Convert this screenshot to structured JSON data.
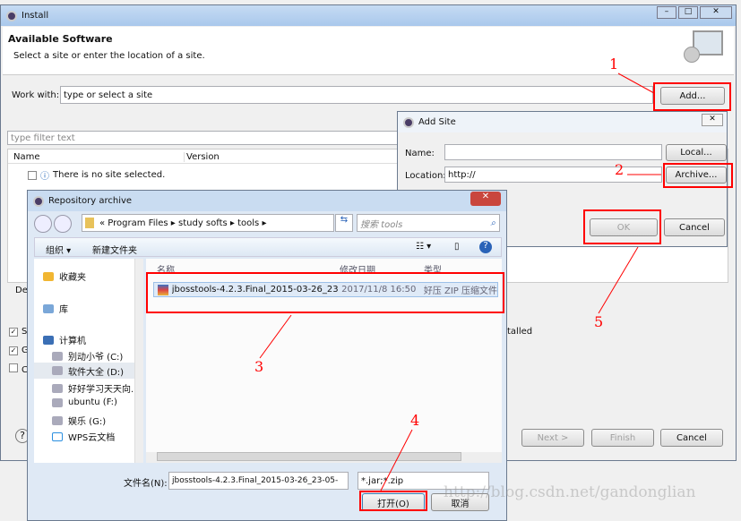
{
  "install": {
    "title": "Install",
    "heading": "Available Software",
    "subheading": "Select a site or enter the location of a site.",
    "work_with_label": "Work with:",
    "work_with_placeholder": "type or select a site",
    "add_button": "Add...",
    "filter_placeholder": "type filter text",
    "columns": [
      "Name",
      "Version"
    ],
    "no_site": "There is no site selected.",
    "checkbox_fragments": [
      "S",
      "G",
      "C"
    ],
    "details_fragment": "De",
    "installed_fragment": "talled",
    "buttons": {
      "next": "Next >",
      "finish": "Finish",
      "cancel": "Cancel"
    }
  },
  "add_site": {
    "title": "Add Site",
    "name_label": "Name:",
    "name_value": "",
    "location_label": "Location:",
    "location_value": "http://",
    "local_button": "Local...",
    "archive_button": "Archive...",
    "ok_button": "OK",
    "cancel_button": "Cancel"
  },
  "repo": {
    "title": "Repository archive",
    "breadcrumb": [
      "Program Files",
      "study softs",
      "tools"
    ],
    "search_placeholder": "搜索 tools",
    "organize": "组织 ▾",
    "new_folder": "新建文件夹",
    "columns": [
      "名称",
      "修改日期",
      "类型"
    ],
    "nav": [
      {
        "label": "收藏夹",
        "icon": "star-icon"
      },
      {
        "label": "库",
        "icon": "library-icon"
      },
      {
        "label": "计算机",
        "icon": "computer-icon"
      },
      {
        "label": "别动小爷 (C:)",
        "icon": "drive-icon"
      },
      {
        "label": "软件大全 (D:)",
        "icon": "drive-icon"
      },
      {
        "label": "好好学习天天向...",
        "icon": "drive-icon"
      },
      {
        "label": "ubuntu (F:)",
        "icon": "drive-icon"
      },
      {
        "label": "娱乐 (G:)",
        "icon": "drive-icon"
      },
      {
        "label": "WPS云文档",
        "icon": "cloud-icon"
      }
    ],
    "file": {
      "name": "jbosstools-4.2.3.Final_2015-03-26_23-...",
      "date": "2017/11/8 16:50",
      "type": "好压 ZIP 压缩文件"
    },
    "filename_label": "文件名(N):",
    "filename_value": "jbosstools-4.2.3.Final_2015-03-26_23-05-",
    "filter_value": "*.jar;*.zip",
    "open_button": "打开(O)",
    "cancel_button": "取消"
  },
  "annotations": [
    "1",
    "2",
    "3",
    "4",
    "5"
  ],
  "watermark": "http://blog.csdn.net/gandonglian",
  "colors": {
    "annotation": "#ff0000",
    "titlebar": "#b9d3f0"
  }
}
